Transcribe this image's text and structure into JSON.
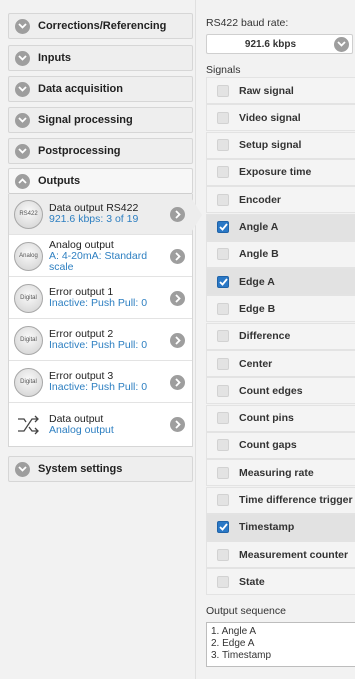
{
  "left": {
    "sections_top": [
      {
        "label": "Corrections/Referencing",
        "state": "collapsed"
      },
      {
        "label": "Inputs",
        "state": "collapsed"
      },
      {
        "label": "Data acquisition",
        "state": "collapsed"
      },
      {
        "label": "Signal processing",
        "state": "collapsed"
      },
      {
        "label": "Postprocessing",
        "state": "collapsed"
      },
      {
        "label": "Outputs",
        "state": "expanded"
      }
    ],
    "outputs": [
      {
        "icon": "RS422",
        "title": "Data output RS422",
        "subtitle": "921.6 kbps: 3 of 19",
        "selected": true
      },
      {
        "icon": "Analog",
        "title": "Analog output",
        "subtitle": "A: 4-20mA: Standard scale",
        "selected": false
      },
      {
        "icon": "Digital",
        "title": "Error output 1",
        "subtitle": "Inactive: Push Pull: 0",
        "selected": false
      },
      {
        "icon": "Digital",
        "title": "Error output 2",
        "subtitle": "Inactive: Push Pull: 0",
        "selected": false
      },
      {
        "icon": "Digital",
        "title": "Error output 3",
        "subtitle": "Inactive: Push Pull: 0",
        "selected": false
      },
      {
        "icon": "switch-arrows-icon",
        "title": "Data output",
        "subtitle": "Analog output",
        "selected": false
      }
    ],
    "system_settings": "System settings"
  },
  "right": {
    "baud_label": "RS422 baud rate:",
    "baud_value": "921.6 kbps",
    "signals_label": "Signals",
    "signals": [
      {
        "label": "Raw signal",
        "checked": false
      },
      {
        "label": "Video signal",
        "checked": false
      },
      {
        "label": "Setup signal",
        "checked": false
      },
      {
        "label": "Exposure time",
        "checked": false
      },
      {
        "label": "Encoder",
        "checked": false
      },
      {
        "label": "Angle A",
        "checked": true
      },
      {
        "label": "Angle B",
        "checked": false
      },
      {
        "label": "Edge A",
        "checked": true
      },
      {
        "label": "Edge B",
        "checked": false
      },
      {
        "label": "Difference",
        "checked": false
      },
      {
        "label": "Center",
        "checked": false
      },
      {
        "label": "Count edges",
        "checked": false
      },
      {
        "label": "Count pins",
        "checked": false
      },
      {
        "label": "Count gaps",
        "checked": false
      },
      {
        "label": "Measuring rate",
        "checked": false
      },
      {
        "label": "Time difference trigger",
        "checked": false
      },
      {
        "label": "Timestamp",
        "checked": true
      },
      {
        "label": "Measurement counter",
        "checked": false
      },
      {
        "label": "State",
        "checked": false
      }
    ],
    "sequence_label": "Output sequence",
    "sequence": [
      "1. Angle A",
      "2. Edge A",
      "3. Timestamp"
    ]
  },
  "colors": {
    "accent": "#2a78c6",
    "link": "#2d7fc1",
    "icon_gray": "#9e9e9e"
  }
}
